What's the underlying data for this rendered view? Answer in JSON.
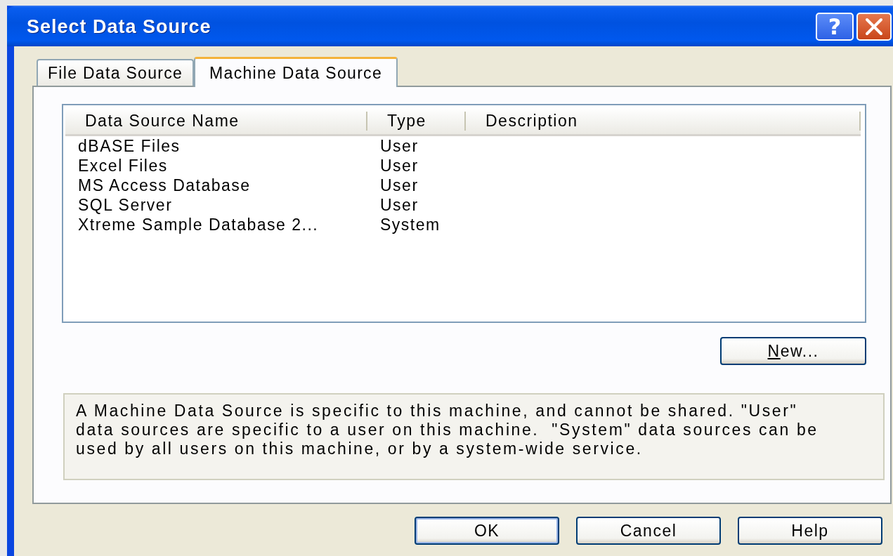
{
  "window": {
    "title": "Select Data Source",
    "help_button": "?"
  },
  "tabs": [
    {
      "label": "File Data Source",
      "selected": false
    },
    {
      "label": "Machine Data Source",
      "selected": true
    }
  ],
  "list": {
    "columns": [
      "Data Source Name",
      "Type",
      "Description"
    ],
    "rows": [
      {
        "name": "dBASE Files",
        "type": "User",
        "selected": false
      },
      {
        "name": "Excel Files",
        "type": "User",
        "selected": false
      },
      {
        "name": "MS Access Database",
        "type": "User",
        "selected": false
      },
      {
        "name": "SQL Server",
        "type": "User",
        "selected": false
      },
      {
        "name": "Xtreme Sample Database 2...",
        "type": "System",
        "selected": false
      }
    ]
  },
  "new_button": {
    "label": "New...",
    "first_letter_underlined": true
  },
  "description": "A Machine Data Source is specific to this machine, and cannot be shared. \"User\" data sources are specific to a user on this machine.  \"System\" data sources can be used by all users on this machine, or by a system-wide service.",
  "buttons": [
    {
      "label": "OK",
      "default": true
    },
    {
      "label": "Cancel",
      "default": false
    },
    {
      "label": "Help",
      "default": false
    }
  ]
}
